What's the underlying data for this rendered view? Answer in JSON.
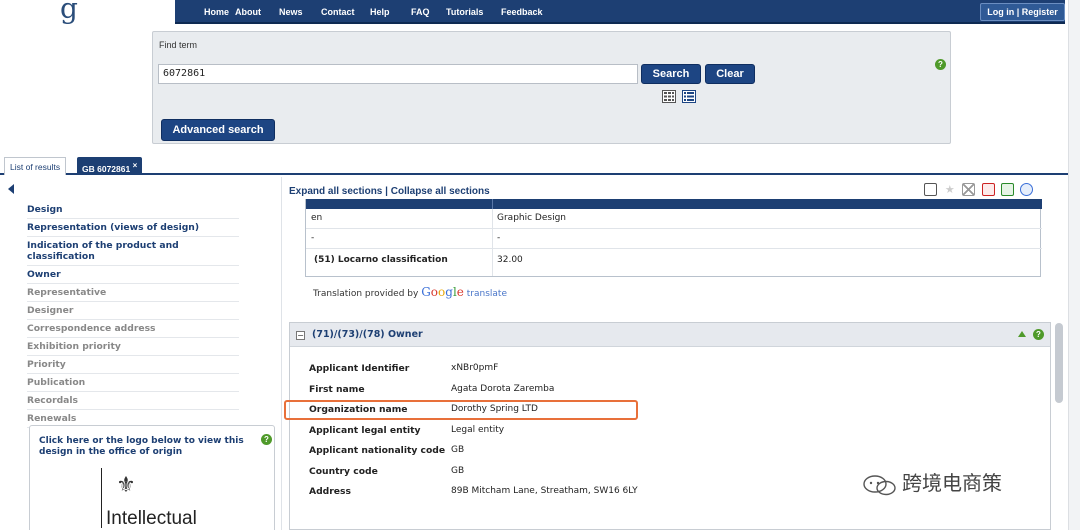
{
  "nav": {
    "items": [
      "Home",
      "About",
      "News",
      "Contact",
      "Help",
      "FAQ",
      "Tutorials",
      "Feedback"
    ],
    "login": "Log in | Register"
  },
  "search": {
    "find_label": "Find term",
    "value": "6072861",
    "search_button": "Search",
    "clear_button": "Clear",
    "advanced_button": "Advanced search",
    "help": "?"
  },
  "tabs": {
    "results": "List of results",
    "active": "GB 6072861",
    "close": "×"
  },
  "sidebar": {
    "items": [
      {
        "label": "Design",
        "state": "active"
      },
      {
        "label": "Representation (views of design)",
        "state": "active"
      },
      {
        "label": "Indication of the product and classification",
        "state": "active"
      },
      {
        "label": "Owner",
        "state": "active"
      },
      {
        "label": "Representative",
        "state": "dim"
      },
      {
        "label": "Designer",
        "state": "dim"
      },
      {
        "label": "Correspondence address",
        "state": "dim"
      },
      {
        "label": "Exhibition priority",
        "state": "dim"
      },
      {
        "label": "Priority",
        "state": "dim"
      },
      {
        "label": "Publication",
        "state": "dim"
      },
      {
        "label": "Recordals",
        "state": "dim"
      },
      {
        "label": "Renewals",
        "state": "dim"
      }
    ],
    "origin_text": "Click here or the logo below to view this design in the office of origin",
    "origin_logo_text": "Intellectual",
    "help": "?"
  },
  "main": {
    "expand_all": "Expand all sections",
    "separator": "|",
    "collapse_all": "Collapse all sections",
    "product_rows": [
      {
        "lang": "en",
        "product": "Graphic Design"
      },
      {
        "lang": "-",
        "product": "-"
      },
      {
        "lang": "(51) Locarno classification",
        "product": "32.00"
      }
    ],
    "translation_prefix": "Translation provided by",
    "google": [
      "G",
      "o",
      "o",
      "g",
      "l",
      "e"
    ],
    "translate_word": "translate",
    "owner_title": "(71)/(73)/(78) Owner",
    "owner_rows": [
      {
        "key": "Applicant Identifier",
        "value": "xNBr0pmF"
      },
      {
        "key": "First name",
        "value": "Agata Dorota Zaremba"
      },
      {
        "key": "Organization name",
        "value": "Dorothy Spring LTD"
      },
      {
        "key": "Applicant legal entity",
        "value": "Legal entity"
      },
      {
        "key": "Applicant nationality code",
        "value": "GB"
      },
      {
        "key": "Country code",
        "value": "GB"
      },
      {
        "key": "Address",
        "value": "89B Mitcham Lane, Streatham, SW16 6LY"
      }
    ],
    "help": "?"
  },
  "watermark": "跨境电商策",
  "colors": {
    "nav_blue": "#1d3f73",
    "button_blue": "#1d4583",
    "highlight_orange": "#e8703a",
    "help_green": "#4f9a2a"
  }
}
